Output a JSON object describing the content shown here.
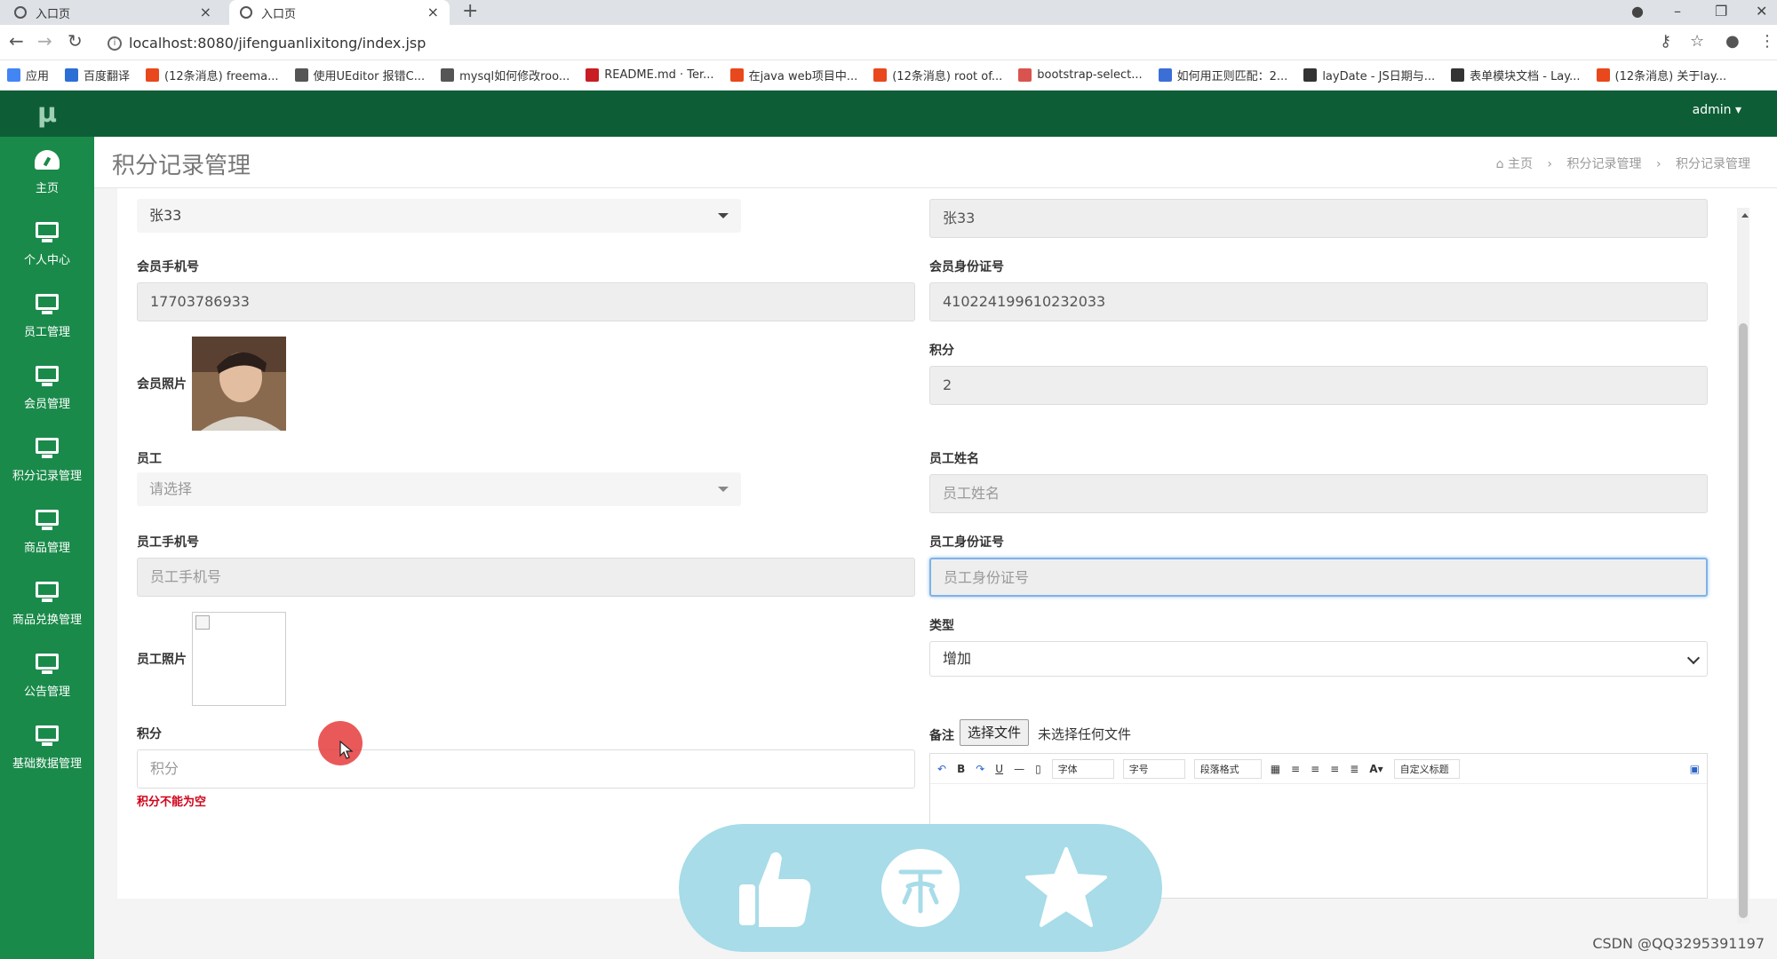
{
  "browser": {
    "tabs": [
      {
        "label": "入口页"
      },
      {
        "label": "入口页"
      }
    ],
    "url": "localhost:8080/jifenguanlixitong/index.jsp",
    "bookmarks": [
      {
        "label": "应用",
        "color": "#4285f4"
      },
      {
        "label": "百度翻译",
        "color": "#2b6fd6"
      },
      {
        "label": "(12条消息) freema...",
        "color": "#e8481b"
      },
      {
        "label": "使用UEditor 报错C...",
        "color": "#555555"
      },
      {
        "label": "mysql如何修改roo...",
        "color": "#555555"
      },
      {
        "label": "README.md · Ter...",
        "color": "#c71d23"
      },
      {
        "label": "在java web项目中...",
        "color": "#e8481b"
      },
      {
        "label": "(12条消息) root of...",
        "color": "#e8481b"
      },
      {
        "label": "bootstrap-select...",
        "color": "#d9534f"
      },
      {
        "label": "如何用正则匹配：2...",
        "color": "#3b6fd6"
      },
      {
        "label": "layDate - JS日期与...",
        "color": "#333333"
      },
      {
        "label": "表单模块文档 - Lay...",
        "color": "#333333"
      },
      {
        "label": "(12条消息) 关于lay...",
        "color": "#e8481b"
      }
    ]
  },
  "app": {
    "logo": "μ",
    "user": "admin ▾",
    "sidebar": [
      {
        "label": "主页",
        "icon": "dashboard-icon"
      },
      {
        "label": "个人中心",
        "icon": "monitor-icon"
      },
      {
        "label": "员工管理",
        "icon": "monitor-icon"
      },
      {
        "label": "会员管理",
        "icon": "monitor-icon"
      },
      {
        "label": "积分记录管理",
        "icon": "monitor-icon"
      },
      {
        "label": "商品管理",
        "icon": "monitor-icon"
      },
      {
        "label": "商品兑换管理",
        "icon": "monitor-icon"
      },
      {
        "label": "公告管理",
        "icon": "monitor-icon"
      },
      {
        "label": "基础数据管理",
        "icon": "monitor-icon"
      }
    ],
    "page_title": "积分记录管理",
    "breadcrumb": [
      "主页",
      "积分记录管理",
      "积分记录管理"
    ]
  },
  "form": {
    "member_select_value": "张33",
    "member_name_value": "张33",
    "member_phone_label": "会员手机号",
    "member_phone_value": "17703786933",
    "member_id_label": "会员身份证号",
    "member_id_value": "410224199610232033",
    "member_photo_label": "会员照片",
    "points_label_right": "积分",
    "points_value_right": "2",
    "employee_label": "员工",
    "employee_placeholder": "请选择",
    "employee_name_label": "员工姓名",
    "employee_name_placeholder": "员工姓名",
    "employee_phone_label": "员工手机号",
    "employee_phone_placeholder": "员工手机号",
    "employee_id_label": "员工身份证号",
    "employee_id_placeholder": "员工身份证号",
    "employee_photo_label": "员工照片",
    "type_label": "类型",
    "type_value": "增加",
    "points_label": "积分",
    "points_placeholder": "积分",
    "points_error": "积分不能为空",
    "remark_label": "备注",
    "file_button": "选择文件",
    "file_status": "未选择任何文件",
    "editor_toolbar": {
      "font": "字体",
      "size": "字号",
      "paragraph": "段落格式",
      "custom_title": "自定义标题"
    }
  },
  "watermark": "CSDN @QQ3295391197"
}
